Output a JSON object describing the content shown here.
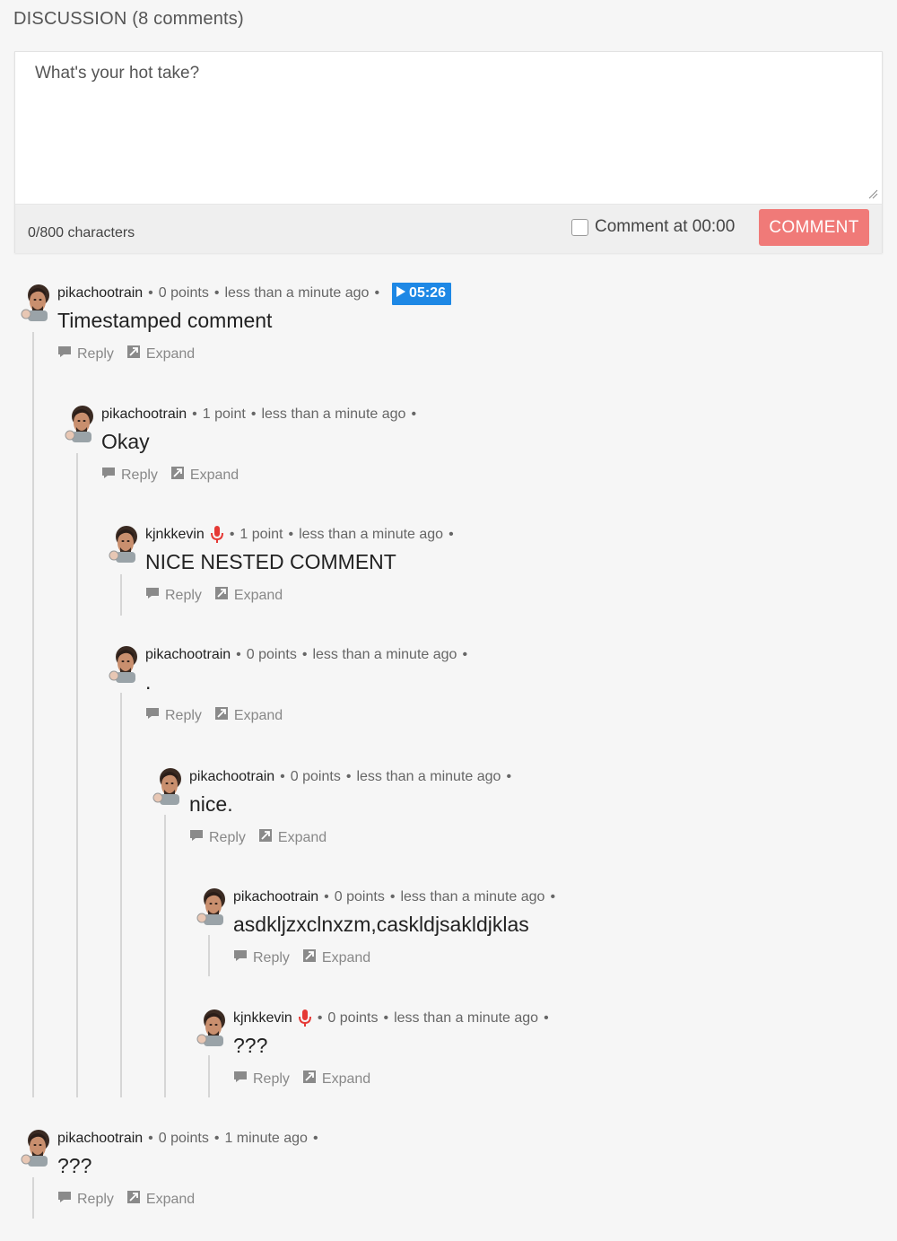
{
  "discussion": {
    "title": "DISCUSSION (8 comments)"
  },
  "composer": {
    "placeholder": "What's your hot take?",
    "char_count": "0/800 characters",
    "timestamp_label": "Comment at 00:00",
    "submit_label": "COMMENT"
  },
  "labels": {
    "reply": "Reply",
    "expand": "Expand",
    "dot": "•"
  },
  "comments": [
    {
      "user": "pikachootrain",
      "points": "0 points",
      "time": "less than a minute ago",
      "timestamp": "05:26",
      "text": "Timestamped comment"
    },
    {
      "user": "pikachootrain",
      "points": "1 point",
      "time": "less than a minute ago",
      "text": "Okay"
    },
    {
      "user": "kjnkkevin",
      "points": "1 point",
      "time": "less than a minute ago",
      "text": "NICE NESTED COMMENT",
      "voice": true
    },
    {
      "user": "pikachootrain",
      "points": "0 points",
      "time": "less than a minute ago",
      "text": "."
    },
    {
      "user": "pikachootrain",
      "points": "0 points",
      "time": "less than a minute ago",
      "text": "nice."
    },
    {
      "user": "pikachootrain",
      "points": "0 points",
      "time": "less than a minute ago",
      "text": "asdkljzxclnxzm,caskldjsakldjklas"
    },
    {
      "user": "kjnkkevin",
      "points": "0 points",
      "time": "less than a minute ago",
      "text": "???",
      "voice": true
    },
    {
      "user": "pikachootrain",
      "points": "0 points",
      "time": "1 minute ago",
      "text": "???"
    }
  ],
  "colors": {
    "accent_button": "#f07a78",
    "timestamp_badge": "#1e88e5",
    "mic": "#e53935"
  }
}
